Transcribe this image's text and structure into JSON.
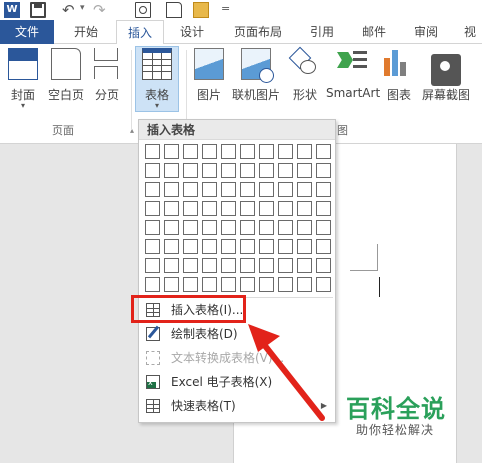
{
  "qat": {
    "app_logo": "W",
    "more": "="
  },
  "tabs": [
    {
      "label": "文件"
    },
    {
      "label": "开始"
    },
    {
      "label": "插入"
    },
    {
      "label": "设计"
    },
    {
      "label": "页面布局"
    },
    {
      "label": "引用"
    },
    {
      "label": "邮件"
    },
    {
      "label": "审阅"
    },
    {
      "label": "视"
    }
  ],
  "active_tab": "插入",
  "ribbon": {
    "pages_group": {
      "label": "页面",
      "buttons": [
        {
          "label": "封面",
          "icon": "cover-page-icon",
          "has_dropdown": true
        },
        {
          "label": "空白页",
          "icon": "blank-page-icon"
        },
        {
          "label": "分页",
          "icon": "page-break-icon"
        }
      ]
    },
    "tables_group": {
      "button": {
        "label": "表格",
        "icon": "table-icon",
        "has_dropdown": true
      }
    },
    "illustrations_group": {
      "label_fragment": "图",
      "buttons": [
        {
          "label": "图片",
          "icon": "picture-icon"
        },
        {
          "label": "联机图片",
          "icon": "online-picture-icon"
        },
        {
          "label": "形状",
          "icon": "shapes-icon",
          "has_dropdown": true
        },
        {
          "label": "SmartArt",
          "icon": "smartart-icon"
        },
        {
          "label": "图表",
          "icon": "chart-icon"
        },
        {
          "label": "屏幕截图",
          "icon": "screenshot-icon",
          "has_dropdown": true
        }
      ]
    }
  },
  "dropdown": {
    "header": "插入表格",
    "grid": {
      "columns": 10,
      "rows": 8
    },
    "items": [
      {
        "label": "插入表格(I)...",
        "icon": "insert-table-icon",
        "enabled": true,
        "highlighted": true
      },
      {
        "label": "绘制表格(D)",
        "icon": "draw-table-icon",
        "enabled": true
      },
      {
        "label": "文本转换成表格(V)...",
        "icon": "text-to-table-icon",
        "enabled": false
      },
      {
        "label": "Excel 电子表格(X)",
        "icon": "excel-spreadsheet-icon",
        "enabled": true
      },
      {
        "label": "快速表格(T)",
        "icon": "quick-tables-icon",
        "enabled": true,
        "has_submenu": true
      }
    ]
  },
  "watermark": {
    "title": "百科全说",
    "subtitle": "助你轻松解决"
  },
  "colors": {
    "accent": "#2b579a",
    "highlight_red": "#e2231a",
    "watermark_green": "#2aa05a"
  }
}
